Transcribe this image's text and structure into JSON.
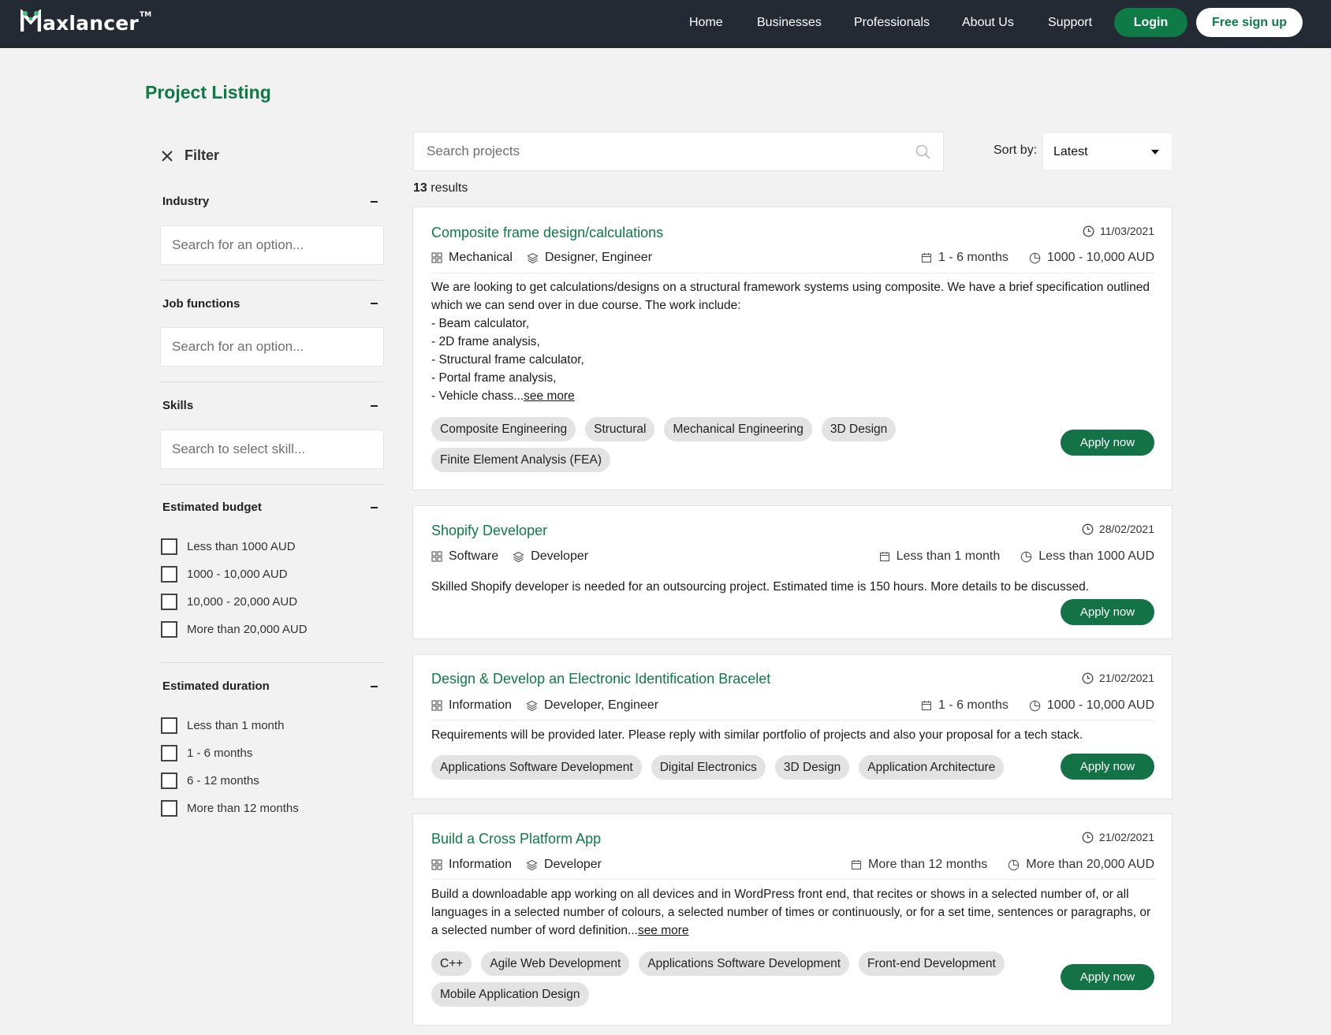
{
  "header": {
    "logo_text": "axlancer",
    "logo_tm": "TM",
    "nav": [
      "Home",
      "Businesses",
      "Professionals",
      "About Us",
      "Support"
    ],
    "login_label": "Login",
    "signup_label": "Free sign up",
    "bg_color": "#232a33",
    "accent_color": "#0e7a46"
  },
  "page_title": "Project Listing",
  "filter": {
    "title": "Filter",
    "sections": {
      "industry": {
        "title": "Industry",
        "placeholder": "Search for an option..."
      },
      "job_functions": {
        "title": "Job functions",
        "placeholder": "Search for an option..."
      },
      "skills": {
        "title": "Skills",
        "placeholder": "Search to select skill..."
      },
      "budget": {
        "title": "Estimated budget",
        "options": [
          "Less than 1000 AUD",
          "1000 - 10,000 AUD",
          "10,000 - 20,000 AUD",
          "More than 20,000 AUD"
        ]
      },
      "duration": {
        "title": "Estimated duration",
        "options": [
          "Less than 1 month",
          "1 - 6 months",
          "6 - 12 months",
          "More than 12 months"
        ]
      }
    }
  },
  "search": {
    "placeholder": "Search projects"
  },
  "sort": {
    "label": "Sort by:",
    "value": "Latest"
  },
  "results": {
    "count": "13",
    "label": "results"
  },
  "projects": [
    {
      "title": "Composite frame design/calculations",
      "date": "11/03/2021",
      "industry": "Mechanical",
      "roles": [
        "Designer,",
        "Engineer"
      ],
      "duration": "1 - 6 months",
      "budget": "1000 - 10,000 AUD",
      "description_lines": [
        "We are looking to get calculations/designs on a structural framework systems using composite. We have a brief specification outlined which we can send over in due course. The work include:",
        "- Beam calculator,",
        "- 2D frame analysis,",
        "- Structural frame calculator,",
        "- Portal frame analysis,",
        "- Vehicle chass..."
      ],
      "see_more": "see more",
      "tags": [
        "Composite Engineering",
        "Structural",
        "Mechanical Engineering",
        "3D Design",
        "Finite Element Analysis (FEA)"
      ],
      "apply_label": "Apply now"
    },
    {
      "title": "Shopify Developer",
      "date": "28/02/2021",
      "industry": "Software",
      "roles": [
        "Developer"
      ],
      "duration": "Less than 1 month",
      "budget": "Less than 1000 AUD",
      "description_lines": [
        "Skilled Shopify developer is needed for an outsourcing project. Estimated time is 150 hours. More details to be discussed."
      ],
      "see_more": "",
      "tags": [],
      "apply_label": "Apply now"
    },
    {
      "title": "Design & Develop an Electronic Identification Bracelet",
      "date": "21/02/2021",
      "industry": "Information",
      "roles": [
        "Developer,",
        "Engineer"
      ],
      "duration": "1 - 6 months",
      "budget": "1000 - 10,000 AUD",
      "description_lines": [
        "Requirements will be provided later. Please reply with similar portfolio of projects and also your proposal for a tech stack."
      ],
      "see_more": "",
      "tags": [
        "Applications Software Development",
        "Digital Electronics",
        "3D Design",
        "Application Architecture"
      ],
      "apply_label": "Apply now"
    },
    {
      "title": "Build a Cross Platform App",
      "date": "21/02/2021",
      "industry": "Information",
      "roles": [
        "Developer"
      ],
      "duration": "More than 12 months",
      "budget": "More than 20,000 AUD",
      "description_lines": [
        "Build a downloadable app working on all devices and in WordPress front end, that recites or shows in a selected number of, or all languages in a selected number of colours, a selected number of times or continuously, or for a set time, sentences or paragraphs, or a selected number of word definition..."
      ],
      "see_more": "see more",
      "tags": [
        "C++",
        "Agile Web Development",
        "Applications Software Development",
        "Front-end Development",
        "Mobile Application Design"
      ],
      "apply_label": "Apply now"
    }
  ]
}
